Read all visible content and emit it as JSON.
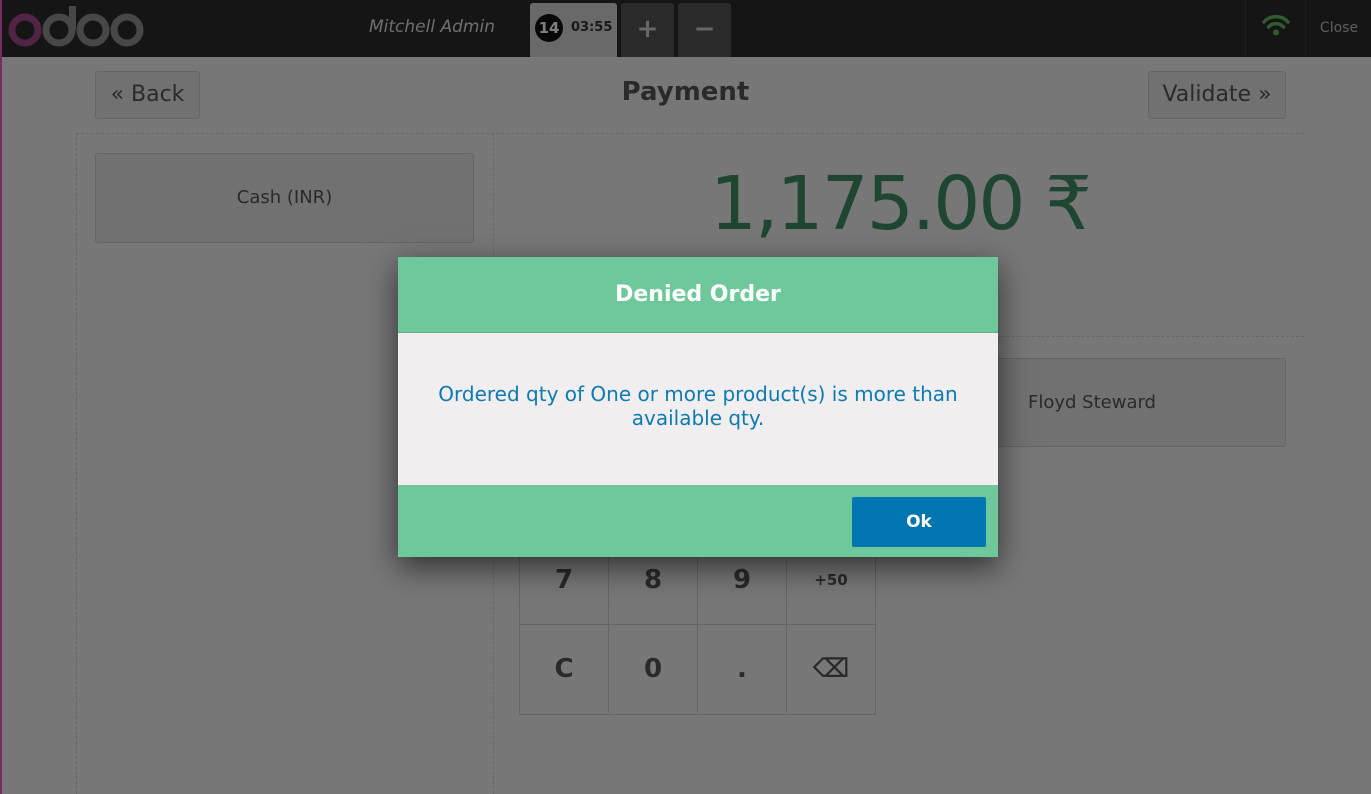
{
  "header": {
    "logo_text": "odoo",
    "user_name": "Mitchell Admin",
    "order": {
      "number": "14",
      "time": "03:55"
    },
    "add_order_label": "+",
    "remove_order_label": "−",
    "close_label": "Close"
  },
  "payment": {
    "back_label": "« Back",
    "title": "Payment",
    "validate_label": "Validate »",
    "payment_method": "Cash (INR)",
    "total": "1,175.00 ₹",
    "customer": "Floyd Steward",
    "numpad": [
      "7",
      "8",
      "9",
      "+50",
      "C",
      "0",
      ".",
      "⌫"
    ]
  },
  "modal": {
    "title": "Denied Order",
    "message": "Ordered qty of One or more product(s) is more than available qty.",
    "ok_label": "Ok"
  },
  "colors": {
    "header_bg": "#2b2b2b",
    "modal_accent": "#6ec89b",
    "primary_button": "#0075b0",
    "total_text": "#3f8c62",
    "wifi_ok": "#5cb85c",
    "logo_accent": "#a24689"
  }
}
